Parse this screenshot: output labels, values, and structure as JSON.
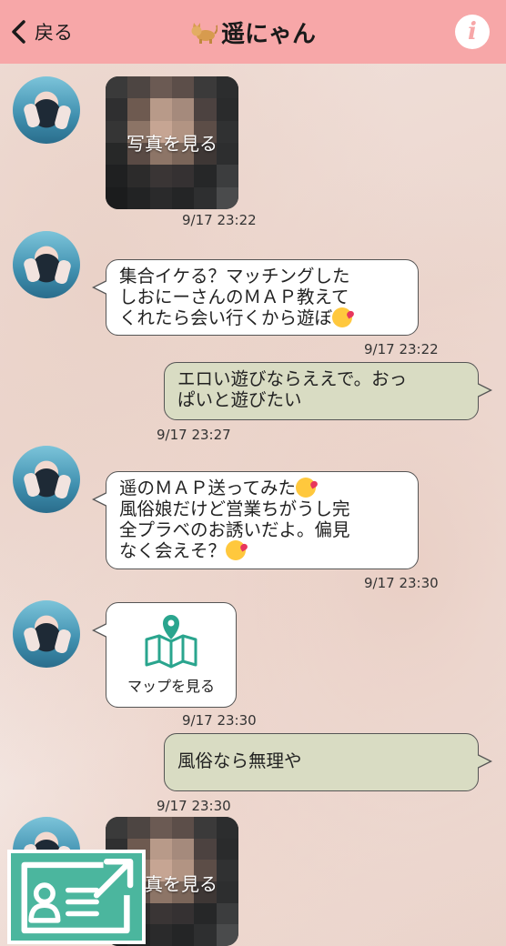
{
  "header": {
    "back_label": "戻る",
    "title": "遥にゃん",
    "info_label": "i",
    "bg_color": "#f7a7a8"
  },
  "messages": [
    {
      "side": "left",
      "type": "photo",
      "label": "写真を見る",
      "time": "9/17 23:22"
    },
    {
      "side": "left",
      "type": "text",
      "lines": [
        "集合イケる？マッチングした",
        "しおにーさんのＭＡＰ教えて",
        "くれたら会い行くから遊ぼ"
      ],
      "emoji": "kiss-emoji",
      "time": "9/17 23:22"
    },
    {
      "side": "right",
      "type": "text",
      "lines": [
        "エロい遊びならええで。おっ",
        "ぱいと遊びたい"
      ],
      "time": "9/17 23:27"
    },
    {
      "side": "left",
      "type": "text",
      "lines": [
        "遥のＭＡＰ送ってみた",
        "風俗娘だけど営業ちがうし完",
        "全プラベのお誘いだよ。偏見",
        "なく会えそ？"
      ],
      "emoji": "smiling-hearts-emoji",
      "time": "9/17 23:30"
    },
    {
      "side": "left",
      "type": "map",
      "label": "マップを見る",
      "time": "9/17 23:30"
    },
    {
      "side": "right",
      "type": "text",
      "lines": [
        "風俗なら無理や"
      ],
      "time": "9/17 23:30"
    },
    {
      "side": "left",
      "type": "photo",
      "label": "写真を見る",
      "time": ""
    }
  ],
  "colors": {
    "received_bubble": "#ffffff",
    "sent_bubble": "#d9dcc3",
    "profile_button": "#4bb69e",
    "map_icon": "#2aa58e"
  },
  "icons": [
    "back-chevron-icon",
    "cat-icon",
    "info-icon",
    "map-pin-icon",
    "profile-card-icon"
  ]
}
